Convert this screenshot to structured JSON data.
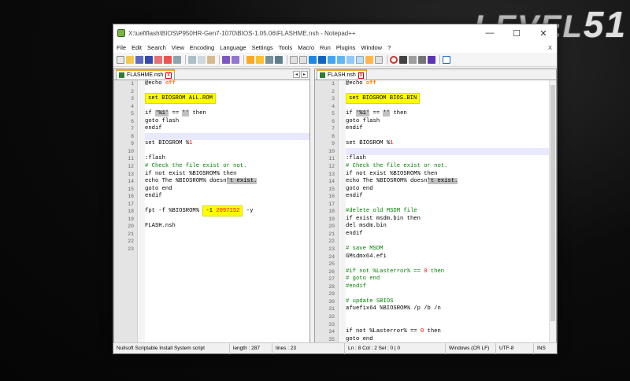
{
  "window": {
    "title": "X:\\uefiflash\\BIOS\\P950HR-Gen7-1070\\BIOS-1.05.06\\FLASHME.nsh - Notepad++",
    "minimize": "—",
    "maximize": "☐",
    "close": "✕"
  },
  "logo": {
    "text": "LEVEL",
    "number": "51"
  },
  "menu": {
    "items": [
      "File",
      "Edit",
      "Search",
      "View",
      "Encoding",
      "Language",
      "Settings",
      "Tools",
      "Macro",
      "Run",
      "Plugins",
      "Window",
      "?"
    ],
    "close": "X"
  },
  "left_pane": {
    "tab": "FLASHME.nsh",
    "line_numbers": [
      "1",
      "2",
      "3",
      "4",
      "5",
      "6",
      "7",
      "8",
      "9",
      "10",
      "11",
      "12",
      "13",
      "14",
      "15",
      "16",
      "17",
      "18",
      "19",
      "20",
      "21",
      "22",
      "23"
    ],
    "lines": {
      "l1a": "@echo ",
      "l1b": "off",
      "l3": "set BIOSROM ALL.ROM",
      "l5a": "if ",
      "l5b": "'%1'",
      "l5c": " == ",
      "l5d": "''",
      "l5e": " then",
      "l6": "goto flash",
      "l7": "endif",
      "l9a": "set BIOSROM %",
      "l9b": "1",
      "l11": ":flash",
      "l12": "# Check the file exist or not.",
      "l13": "if not exist %BIOSROM% then",
      "l14a": "echo The %BIOSROM% doesn",
      "l14b": "'t exist.",
      "l15": "goto end",
      "l16": "endif",
      "l18a": "fpt -f %BIOSROM% ",
      "l18b": "-1 ",
      "l18c": "2097152",
      "l18d": " -y",
      "l20": "FLASH.nsh"
    }
  },
  "right_pane": {
    "tab": "FLASH.nsh",
    "line_numbers": [
      "1",
      "2",
      "3",
      "4",
      "5",
      "6",
      "7",
      "8",
      "9",
      "10",
      "11",
      "12",
      "13",
      "14",
      "15",
      "16",
      "17",
      "18",
      "19",
      "20",
      "21",
      "22",
      "23",
      "24",
      "25",
      "26",
      "27",
      "28",
      "29",
      "30",
      "31",
      "32",
      "33",
      "34",
      "35"
    ],
    "lines": {
      "l1a": "@echo ",
      "l1b": "off",
      "l3": "set BIOSROM BIOS.BIN",
      "l5a": "if ",
      "l5b": "'%1'",
      "l5c": " == ",
      "l5d": "''",
      "l5e": " then",
      "l6": "goto flash",
      "l7": "endif",
      "l9a": "set BIOSROM %",
      "l9b": "1",
      "l11": ":flash",
      "l12": "# Check the file exist or not.",
      "l13": "if not exist %BIOSROM% then",
      "l14a": "echo The %BIOSROM% doesn",
      "l14b": "'t exist.",
      "l15": "goto end",
      "l16": "endif",
      "l18": "#delete old MSDM file",
      "l19": "if exist msdm.bin then",
      "l20": "del msdm.bin",
      "l21": "endif",
      "l23": "# save MSDM",
      "l24": "GMsdmx64.efi",
      "l26a": "#if not %Lasterror% == ",
      "l26b": "0",
      "l26c": " then",
      "l27": "# goto end",
      "l28": "#endif",
      "l30": "# update SBIOS",
      "l31": "afuefix64 %BIOSROM% /p /b /n",
      "l34a": "if not %Lasterror% == ",
      "l34b": "0",
      "l34c": " then",
      "l35": "goto end"
    }
  },
  "status": {
    "lang": "Nullsoft Scriptable Install System script",
    "length": "length : 287",
    "lines": "lines : 23",
    "pos": "Ln : 8    Col : 2    Sel : 0 | 0",
    "eol": "Windows (CR LF)",
    "enc": "UTF-8",
    "mode": "INS"
  },
  "colors": {
    "highlight": "#ffff00",
    "keyword": "#ff8000",
    "comment": "#008000",
    "number": "#ff0000",
    "tab_accent": "#f5a623"
  },
  "toolbar_icons": [
    "new-icon",
    "open-icon",
    "save-icon",
    "save-all-icon",
    "close-icon",
    "close-all-icon",
    "print-icon",
    "cut-icon",
    "copy-icon",
    "paste-icon",
    "undo-icon",
    "redo-icon",
    "find-icon",
    "replace-icon",
    "zoom-in-icon",
    "zoom-out-icon",
    "sync-v-icon",
    "sync-h-icon",
    "wrap-icon",
    "all-chars-icon",
    "indent-guide-icon",
    "udl-icon",
    "doc-map-icon",
    "func-list-icon",
    "folder-icon",
    "monitor-icon",
    "record-icon",
    "stop-icon",
    "play-icon",
    "play-multi-icon",
    "save-macro-icon",
    "spell-icon"
  ]
}
